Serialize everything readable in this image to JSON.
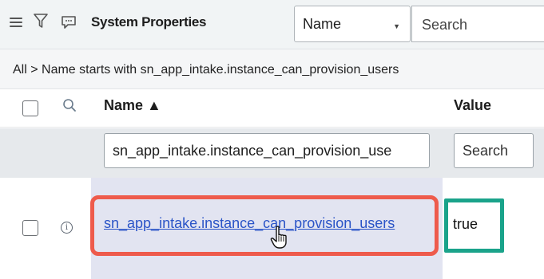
{
  "header": {
    "title": "System Properties",
    "field_select": "Name",
    "search_placeholder": "Search"
  },
  "breadcrumb": {
    "text": "All > Name starts with sn_app_intake.instance_can_provision_users"
  },
  "columns": {
    "name": "Name ▲",
    "value": "Value"
  },
  "filter_row": {
    "name_filter_value": "sn_app_intake.instance_can_provision_use",
    "value_search": "Search"
  },
  "rows": [
    {
      "name": "sn_app_intake.instance_can_provision_users",
      "value": "true"
    }
  ],
  "colors": {
    "link": "#2a54c7",
    "highlight_red": "#ee5b4c",
    "highlight_green": "#1aa38a"
  }
}
